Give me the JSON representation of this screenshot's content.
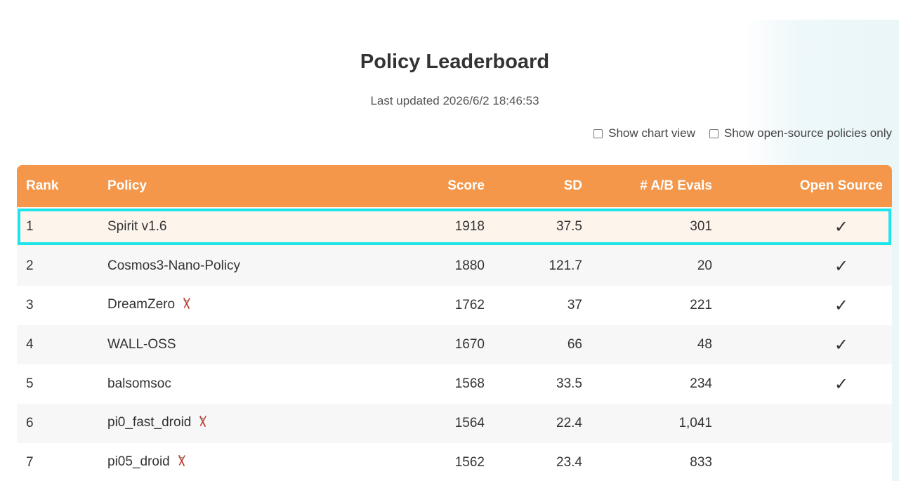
{
  "header": {
    "title": "Policy Leaderboard",
    "last_updated": "Last updated 2026/6/2 18:46:53"
  },
  "options": {
    "chart_view_label": "Show chart view",
    "open_source_only_label": "Show open-source policies only"
  },
  "table": {
    "columns": {
      "rank": "Rank",
      "policy": "Policy",
      "score": "Score",
      "sd": "SD",
      "evals": "# A/B Evals",
      "open_source": "Open Source"
    },
    "rows": [
      {
        "rank": "1",
        "policy": "Spirit v1.6",
        "flagged": false,
        "score": "1918",
        "sd": "37.5",
        "evals": "301",
        "open": "✓",
        "selected": true
      },
      {
        "rank": "2",
        "policy": "Cosmos3-Nano-Policy",
        "flagged": false,
        "score": "1880",
        "sd": "121.7",
        "evals": "20",
        "open": "✓",
        "selected": false
      },
      {
        "rank": "3",
        "policy": "DreamZero",
        "flagged": true,
        "score": "1762",
        "sd": "37",
        "evals": "221",
        "open": "✓",
        "selected": false
      },
      {
        "rank": "4",
        "policy": "WALL-OSS",
        "flagged": false,
        "score": "1670",
        "sd": "66",
        "evals": "48",
        "open": "✓",
        "selected": false
      },
      {
        "rank": "5",
        "policy": "balsomsoc",
        "flagged": false,
        "score": "1568",
        "sd": "33.5",
        "evals": "234",
        "open": "✓",
        "selected": false
      },
      {
        "rank": "6",
        "policy": "pi0_fast_droid",
        "flagged": true,
        "score": "1564",
        "sd": "22.4",
        "evals": "1,041",
        "open": "",
        "selected": false
      },
      {
        "rank": "7",
        "policy": "pi05_droid",
        "flagged": true,
        "score": "1562",
        "sd": "23.4",
        "evals": "833",
        "open": "",
        "selected": false
      }
    ]
  },
  "icons": {
    "flag": "crossed-flag-icon",
    "check": "checkmark-icon"
  },
  "colors": {
    "header_bg": "#f4974a",
    "highlight_border": "#1de5ec",
    "highlight_row_bg": "#fdf4ec",
    "flag_color": "#c0392b"
  }
}
